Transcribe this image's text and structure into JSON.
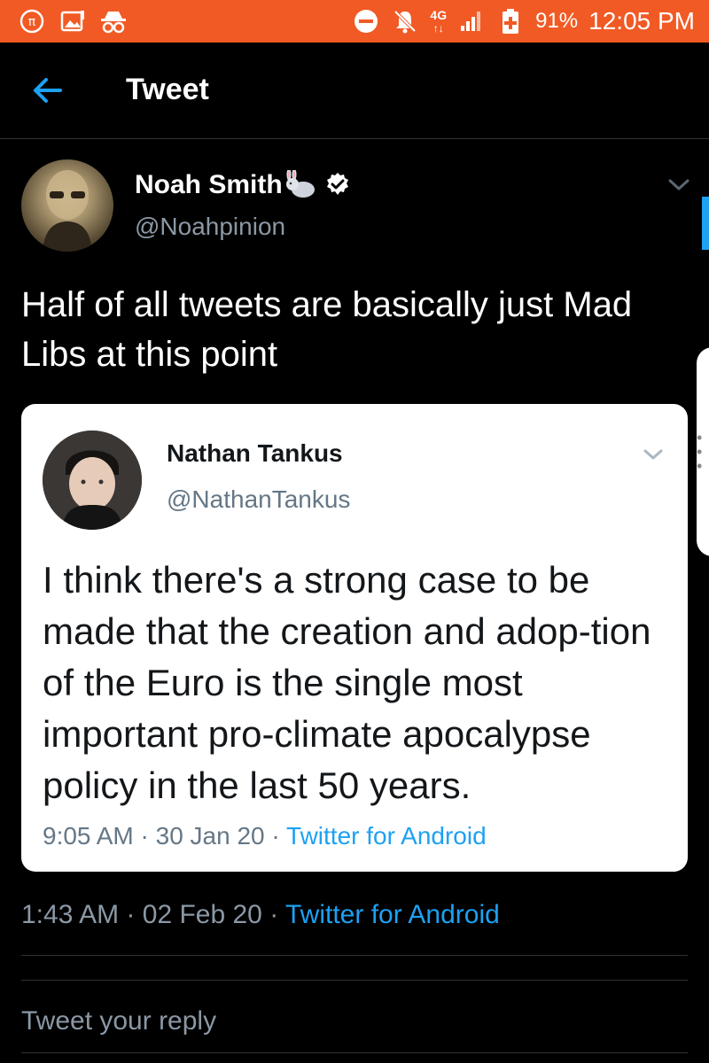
{
  "status_bar": {
    "network": "4G",
    "battery": "91%",
    "time": "12:05 PM",
    "background": "#f15a24"
  },
  "header": {
    "title": "Tweet"
  },
  "tweet": {
    "author_name": "Noah Smith",
    "handle": "@Noahpinion",
    "text": "Half of all tweets are basically just Mad Libs at this point",
    "timestamp": "1:43 AM",
    "date": "02 Feb 20",
    "source": "Twitter for Android"
  },
  "quoted_tweet": {
    "author_name": "Nathan Tankus",
    "handle": "@NathanTankus",
    "text": "I think there's a strong case to be made that the creation and adop-tion of the Euro is the single most important pro-climate apocalypse policy in the last 50 years.",
    "timestamp": "9:05 AM",
    "date": "30 Jan 20",
    "source": "Twitter for Android"
  },
  "reply": {
    "placeholder": "Tweet your reply"
  },
  "meta_separator": "·",
  "colors": {
    "accent": "#1da1f2",
    "background": "#000000",
    "muted": "#8b98a5"
  },
  "icons": {
    "back": "arrow-left-icon",
    "verified": "verified-badge-icon",
    "emoji": "rabbit-emoji-icon",
    "more": "chevron-down-icon"
  }
}
